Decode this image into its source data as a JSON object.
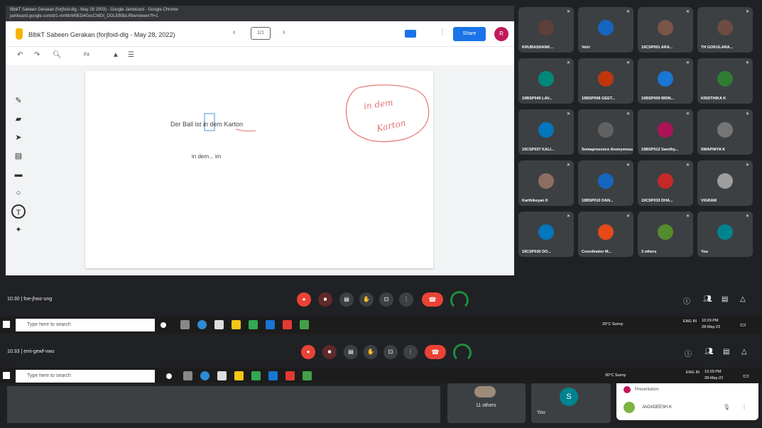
{
  "browser": {
    "tab_text": "BlbkT Sabeen Gerakan (forjfoid-dlg - May 28 2003) - Google Jamboard - Google Chrome",
    "url": "jamboard.google.com/d/1-m/rMxM9ED4GxcCWDt_DOLEB5bLRbe/viewer?f=1"
  },
  "jamboard": {
    "title": "BlbkT Sabeen Gerakan (forjfoid-dlg - May 28, 2022)",
    "frame_label": "1/1",
    "share_label": "Share",
    "avatar_letter": "R",
    "toolbar": {
      "zoom_label": "Fit",
      "set_bg_label": "Set background",
      "clear_label": "Clear frame"
    },
    "canvas": {
      "sentence": "Der Ball ist in dem Karton",
      "note": "in dem... im",
      "handwriting_top": "in dem",
      "handwriting_bottom": "Karton"
    }
  },
  "participants": [
    {
      "name": "KRUBASHANK...",
      "color": "#5d4037"
    },
    {
      "name": "Vetri",
      "color": "#1565c0"
    },
    {
      "name": "19CSP001 ARA...",
      "color": "#795548"
    },
    {
      "name": "TH GOKULARA...",
      "color": "#6d4c41"
    },
    {
      "name": "19BSP049 LAV...",
      "color": "#00897b"
    },
    {
      "name": "19BSP008 GEET...",
      "color": "#bf360c"
    },
    {
      "name": "19BSP009 BRIN...",
      "color": "#1976d2"
    },
    {
      "name": "KRISTHIKA K",
      "color": "#2e7d32"
    },
    {
      "name": "19CSP037 KALI...",
      "color": "#0277bd"
    },
    {
      "name": "Somapresence Anonymous Sandhy...",
      "color": "#616161"
    },
    {
      "name": "19BSP012 Sandhy...",
      "color": "#ad1457"
    },
    {
      "name": "SWAPNIYA K",
      "color": "#757575"
    },
    {
      "name": "Karthikeyan K",
      "color": "#8d6e63"
    },
    {
      "name": "19BSP010 DAN...",
      "color": "#1565c0"
    },
    {
      "name": "19CSP033 DHA...",
      "color": "#c62828"
    },
    {
      "name": "VIGRAM",
      "color": "#9e9e9e"
    },
    {
      "name": "19CSP030 DO...",
      "color": "#0277bd"
    },
    {
      "name": "Coordinator M...",
      "color": "#e64a19"
    },
    {
      "name": "3 others",
      "color": "#558b2f"
    },
    {
      "name": "You",
      "color": "#00838f"
    }
  ],
  "meet_bar_1": {
    "time_code": "10:30 | foe-jhwz-ung"
  },
  "meet_bar_2": {
    "time_code": "10:33 | emi-gewf-vwu"
  },
  "taskbar": {
    "search_placeholder": "Type here to search",
    "weather": "29°C Sunny",
    "lang": "ENG IN",
    "time": "10:29 PM",
    "date": "28-May-22"
  },
  "taskbar_2": {
    "search_placeholder": "Type here to search",
    "weather": "30°C Sunny",
    "lang": "ENG IN",
    "time": "10:29 PM",
    "date": "28-May-22"
  },
  "bottom": {
    "others_label": "11 others",
    "you_label": "You",
    "s_letter": "S",
    "panel": {
      "row1": "Presentation",
      "row2_name": "JAGADEESH K"
    }
  }
}
